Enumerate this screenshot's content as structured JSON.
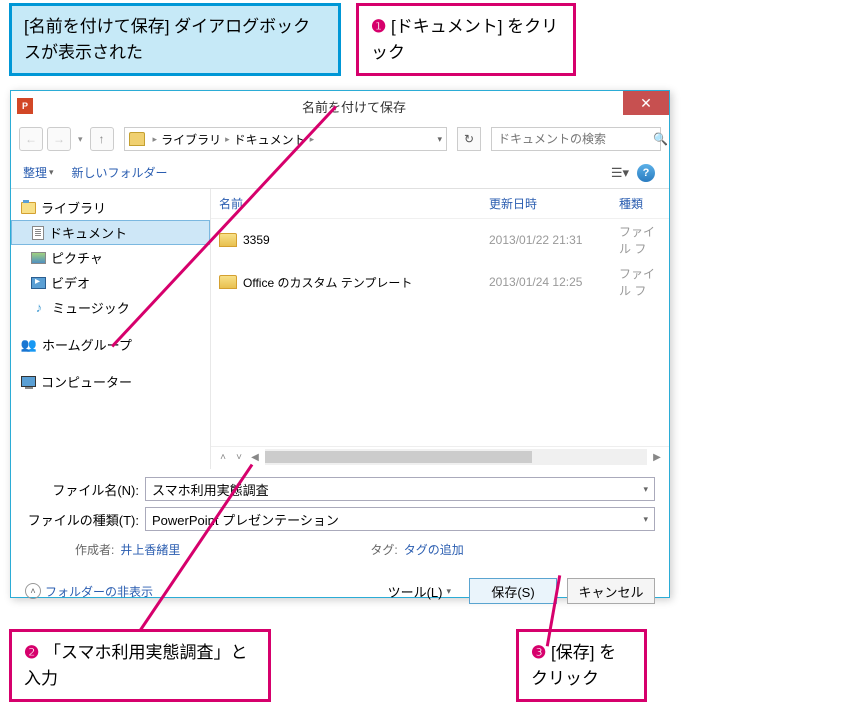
{
  "callouts": {
    "info": "[名前を付けて保存] ダイアログボックスが表示された",
    "step1_num": "❶",
    "step1_text": "[ドキュメント] をクリック",
    "step2_num": "❷",
    "step2_text": "「スマホ利用実態調査」と入力",
    "step3_num": "❸",
    "step3_text": "[保存] をクリック"
  },
  "dialog": {
    "title": "名前を付けて保存",
    "app_icon_text": "P",
    "close_btn": "✕"
  },
  "breadcrumb": {
    "seg1": "ライブラリ",
    "seg2": "ドキュメント"
  },
  "search": {
    "placeholder": "ドキュメントの検索"
  },
  "toolbar": {
    "organize": "整理",
    "new_folder": "新しいフォルダー"
  },
  "sidebar": {
    "libraries": "ライブラリ",
    "documents": "ドキュメント",
    "pictures": "ピクチャ",
    "videos": "ビデオ",
    "music": "ミュージック",
    "homegroup": "ホームグループ",
    "computer": "コンピューター"
  },
  "list": {
    "h_name": "名前",
    "h_date": "更新日時",
    "h_type": "種類",
    "rows": [
      {
        "name": "3359",
        "date": "2013/01/22 21:31",
        "type": "ファイル フ"
      },
      {
        "name": "Office のカスタム テンプレート",
        "date": "2013/01/24 12:25",
        "type": "ファイル フ"
      }
    ]
  },
  "form": {
    "filename_label": "ファイル名(N):",
    "filename_value": "スマホ利用実態調査",
    "filetype_label": "ファイルの種類(T):",
    "filetype_value": "PowerPoint プレゼンテーション",
    "author_label": "作成者:",
    "author_value": "井上香緒里",
    "tag_label": "タグ:",
    "tag_value": "タグの追加"
  },
  "bottom": {
    "expand": "フォルダーの非表示",
    "tools": "ツール(L)",
    "save": "保存(S)",
    "cancel": "キャンセル"
  }
}
